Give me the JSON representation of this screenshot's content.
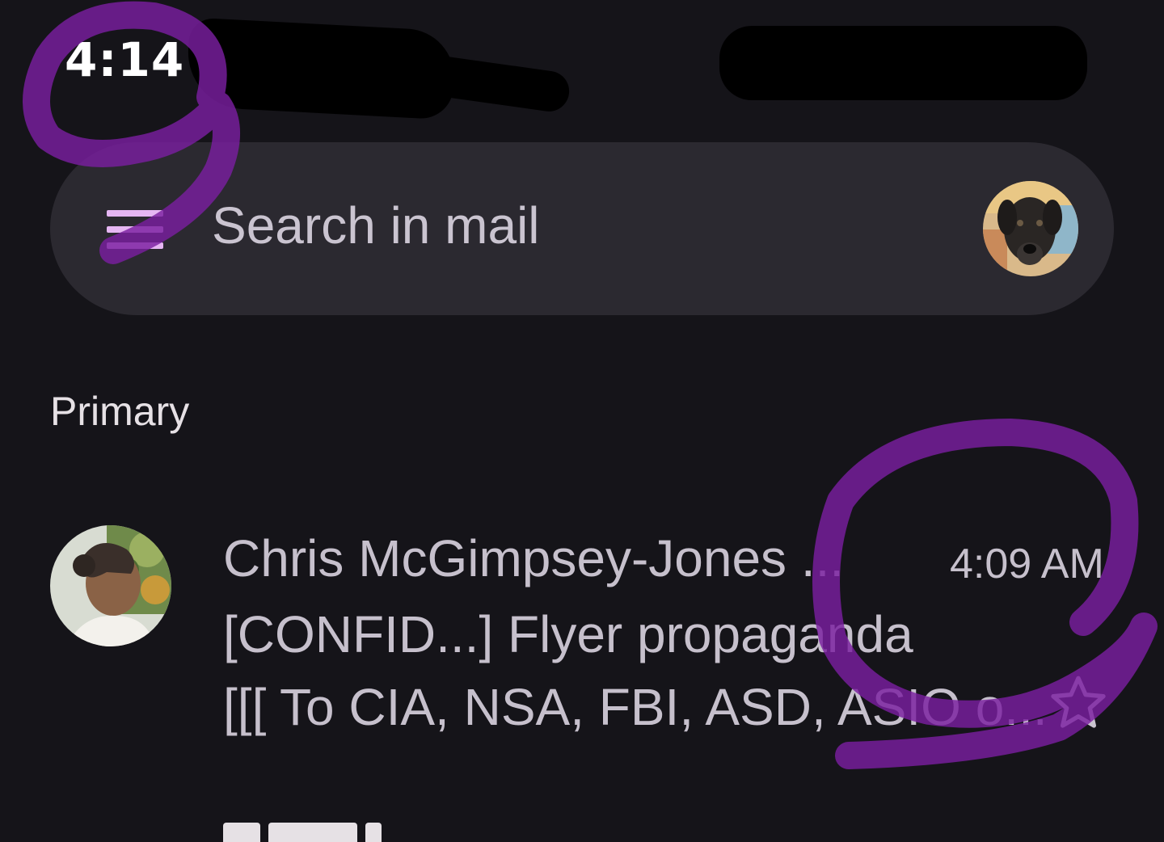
{
  "status_bar": {
    "time": "4:14"
  },
  "search": {
    "placeholder": "Search in mail"
  },
  "icons": {
    "menu": "menu-icon",
    "star": "star-icon"
  },
  "colors": {
    "background": "#151419",
    "search_bar": "#2b2930",
    "accent": "#e6b6f3",
    "text": "#c6c0cc",
    "annotation": "#7a1fa0"
  },
  "inbox": {
    "section_title": "Primary",
    "emails": [
      {
        "sender": "Chris McGimpsey-Jones ...",
        "time": "4:09 AM",
        "subject": "[CONFID...] Flyer propaganda",
        "snippet": "[[[ To CIA, NSA, FBI, ASD, ASIO o..."
      }
    ]
  }
}
